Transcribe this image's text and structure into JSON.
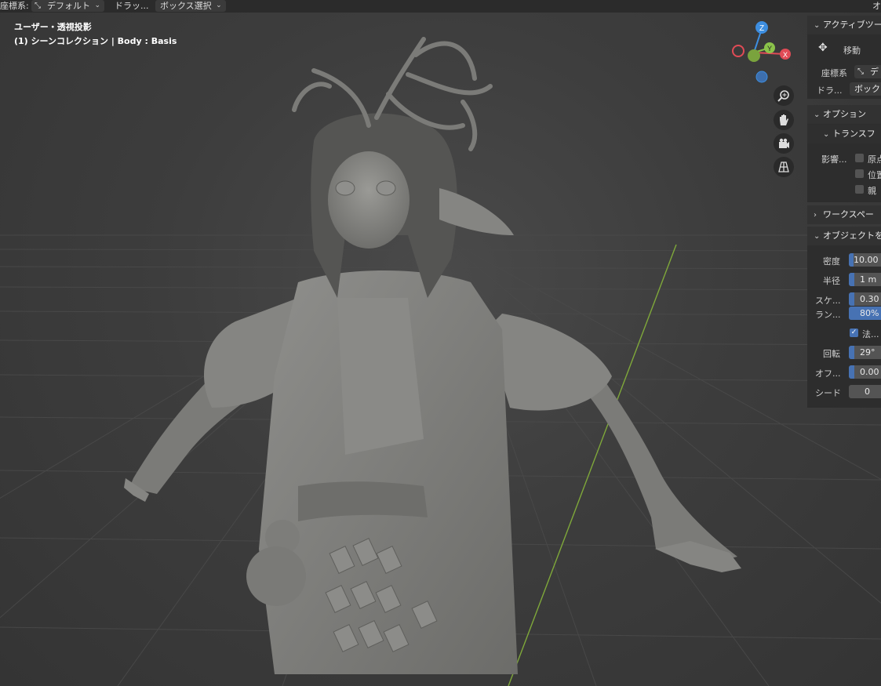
{
  "header": {
    "coord_label": "座標系:",
    "coord_value": "デフォルト",
    "drag_label": "ドラッ...",
    "drag_value": "ボックス選択",
    "options_cut": "オ"
  },
  "viewport": {
    "view_name": "ユーザー・透視投影",
    "collection_info": "(1) シーンコレクション | Body : Basis"
  },
  "gizmo": {
    "axes": [
      "Z",
      "Y",
      "X"
    ],
    "nav_buttons": [
      "zoom-icon",
      "hand-pan-icon",
      "camera-icon",
      "grid-ortho-icon"
    ]
  },
  "panel": {
    "active_tool": {
      "title": "アクティブツー",
      "tool_name": "移動",
      "coord_label": "座標系",
      "coord_value": "デ",
      "drag_label": "ドラ...",
      "drag_value": "ボック"
    },
    "options": {
      "title": "オプション",
      "transform_title": "トランスフ",
      "affect_label": "影響...",
      "checks": [
        {
          "label": "原点",
          "checked": false
        },
        {
          "label": "位置",
          "checked": false
        },
        {
          "label": "親",
          "checked": false
        }
      ]
    },
    "workspace": {
      "title": "ワークスペー"
    },
    "object": {
      "title": "オブジェクトを",
      "rows": [
        {
          "label": "密度",
          "value": "10.00",
          "fill": 0.12
        },
        {
          "label": "半径",
          "value": "1 m",
          "fill": 0.12
        },
        {
          "label": "スケ...",
          "value": "0.30",
          "fill": 0.12
        },
        {
          "label": "ラン...",
          "value": "80%",
          "fill": 0.8
        }
      ],
      "normal_check": {
        "label": "法...",
        "checked": true
      },
      "rows2": [
        {
          "label": "回転",
          "value": "29°",
          "fill": 0.12
        },
        {
          "label": "オフ...",
          "value": "0.00",
          "fill": 0.12
        },
        {
          "label": "シード",
          "value": "0",
          "fill": 0
        }
      ]
    }
  },
  "colors": {
    "accent": "#4772b3",
    "axis_x": "#e14b56",
    "axis_y": "#8bc34a",
    "axis_z": "#3d8ee0"
  }
}
